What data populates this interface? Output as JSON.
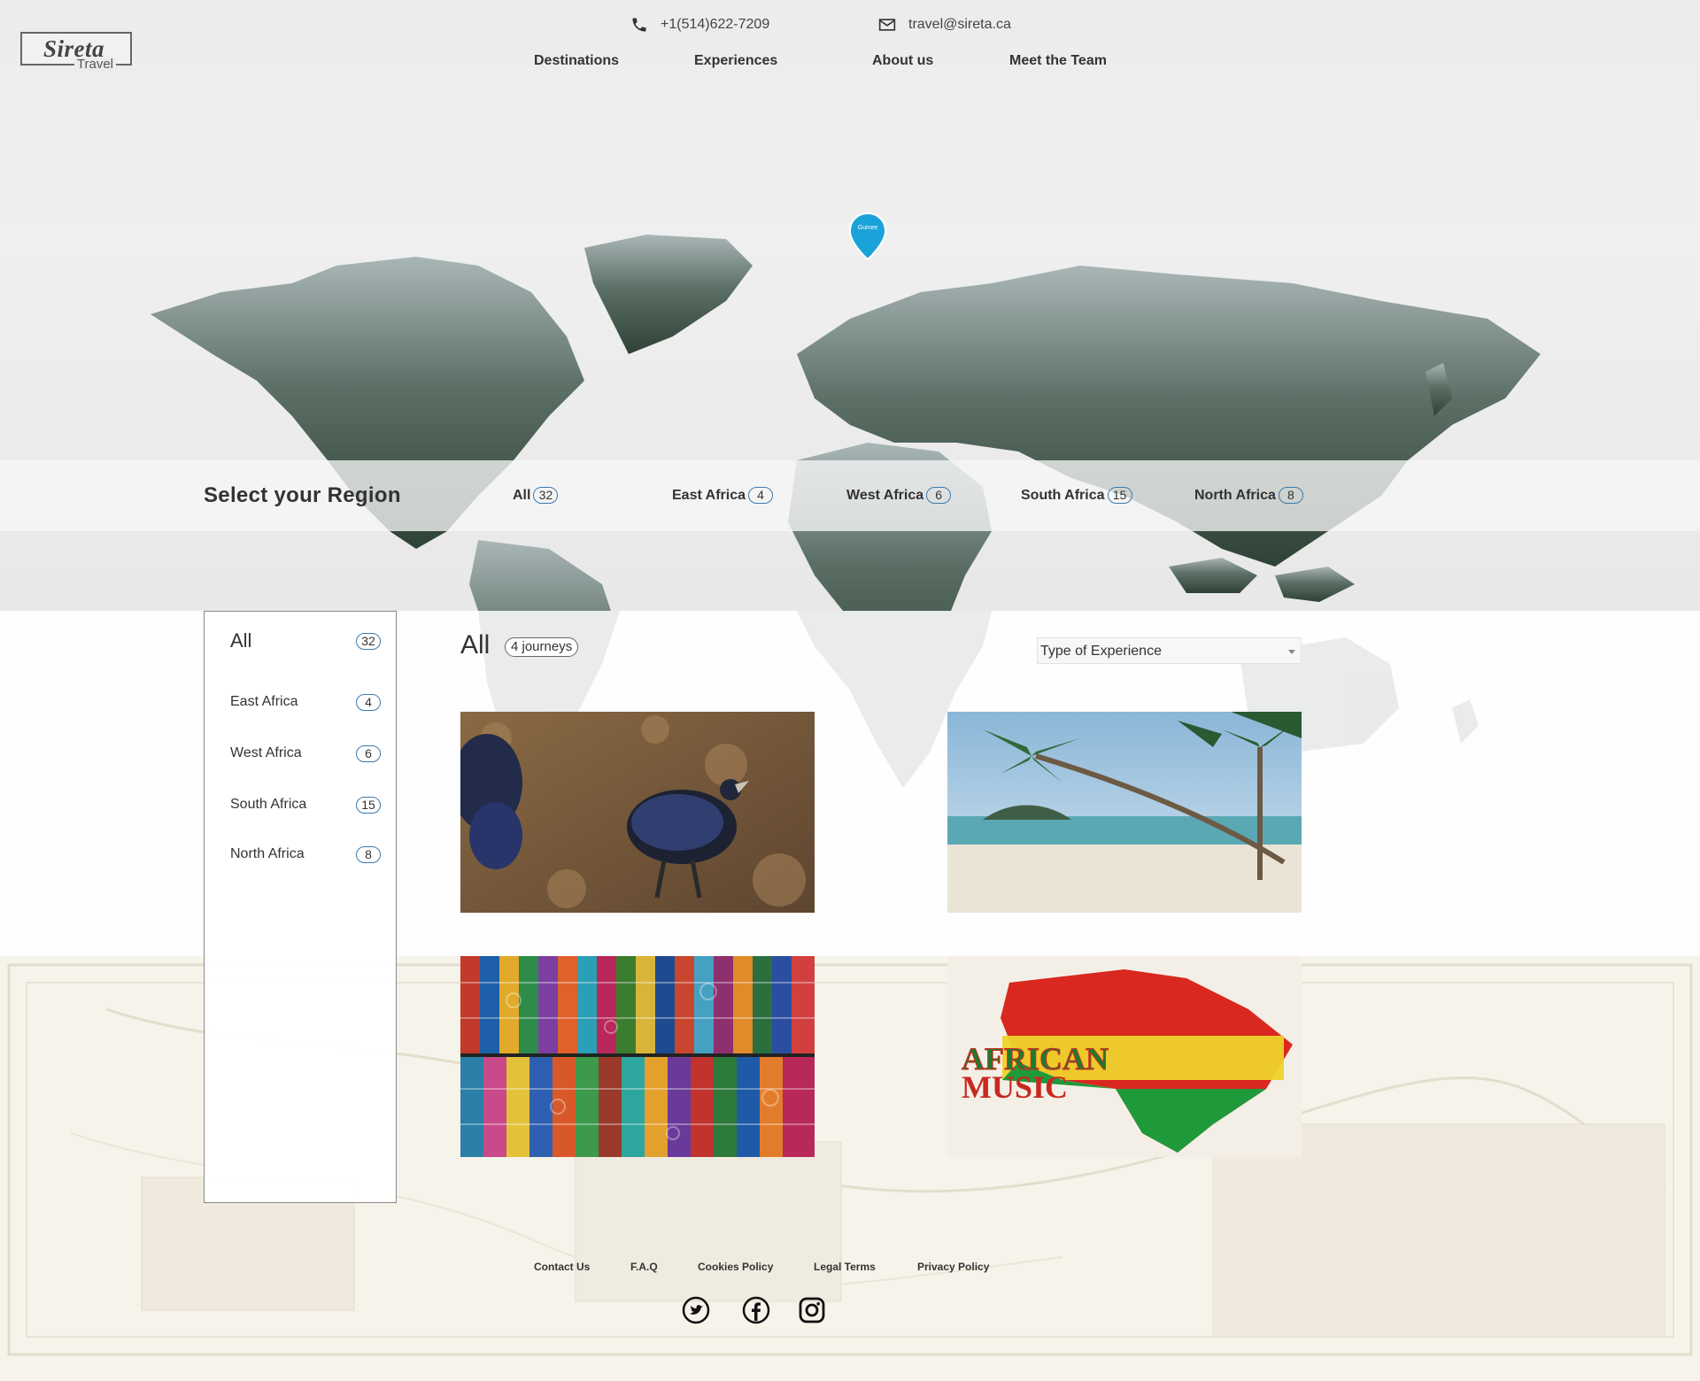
{
  "brand": {
    "logo_main": "Sireta",
    "logo_sub": "Travel"
  },
  "contact": {
    "phone": "+1(514)622-7209",
    "email": "travel@sireta.ca"
  },
  "nav": {
    "items": [
      "Destinations",
      "Experiences",
      "About us",
      "Meet the Team"
    ]
  },
  "map_marker": {
    "label": "Guinee"
  },
  "region_bar": {
    "title": "Select your Region",
    "tabs": [
      {
        "label": "All",
        "count": "32"
      },
      {
        "label": "East Africa",
        "count": "4"
      },
      {
        "label": "West Africa",
        "count": "6"
      },
      {
        "label": "South Africa",
        "count": "15"
      },
      {
        "label": "North Africa",
        "count": "8"
      }
    ]
  },
  "sidebar": {
    "items": [
      {
        "label": "All",
        "count": "32"
      },
      {
        "label": "East Africa",
        "count": "4"
      },
      {
        "label": "West Africa",
        "count": "6"
      },
      {
        "label": "South Africa",
        "count": "15"
      },
      {
        "label": "North Africa",
        "count": "8"
      }
    ]
  },
  "listing": {
    "title": "All",
    "journeys_badge": "4 journeys",
    "filter": {
      "selected": "Type of Experience"
    }
  },
  "cards": [
    {
      "image": "guinea-fowl-photo"
    },
    {
      "image": "palm-beach-photo"
    },
    {
      "image": "african-fabrics-photo"
    },
    {
      "image": "african-music-poster",
      "poster_text": [
        "AFRICAN",
        "MUSIC"
      ]
    }
  ],
  "footer": {
    "links": [
      "Contact Us",
      "F.A.Q",
      "Cookies Policy",
      "Legal Terms",
      "Privacy Policy"
    ],
    "social": [
      "twitter-icon",
      "facebook-icon",
      "instagram-icon"
    ]
  },
  "colors": {
    "accent": "#3a79b0",
    "pin": "#1aa3d8",
    "map_land": "#4d6259"
  }
}
